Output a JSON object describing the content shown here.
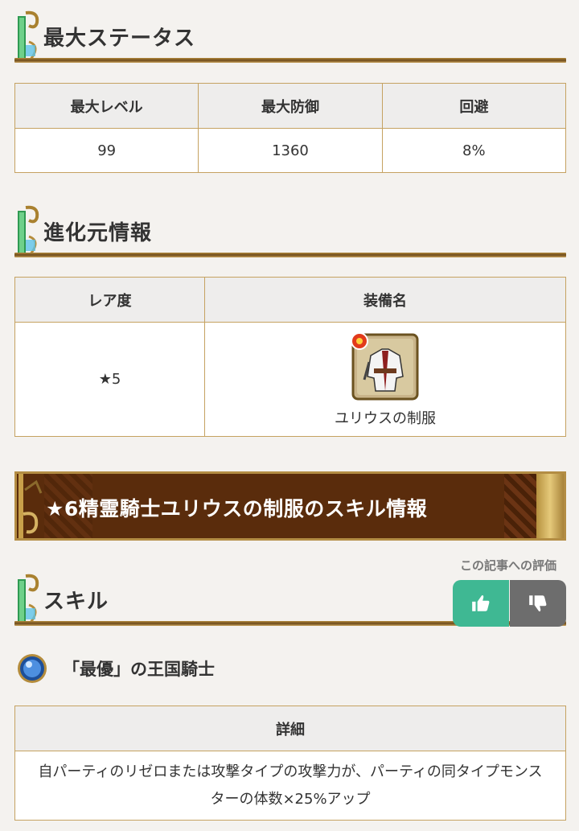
{
  "sections": {
    "max_status": "最大ステータス",
    "evolution_source": "進化元情報",
    "skill": "スキル"
  },
  "max_status_table": {
    "headers": [
      "最大レベル",
      "最大防御",
      "回避"
    ],
    "values": [
      "99",
      "1360",
      "8%"
    ]
  },
  "evolution_table": {
    "headers": [
      "レア度",
      "装備名"
    ],
    "rarity": "★5",
    "equipment_name": "ユリウスの制服",
    "equipment_icon": "uniform-icon"
  },
  "skill_info_banner": "★6精霊騎士ユリウスの制服のスキル情報",
  "rating": {
    "label": "この記事への評価",
    "good_icon": "thumbs-up-icon",
    "bad_icon": "thumbs-down-icon"
  },
  "skill": {
    "icon": "blue-orb-icon",
    "name": "「最優」の王国騎士",
    "table_header": "詳細",
    "detail": "自パーティのリゼロまたは攻撃タイプの攻撃力が、パーティの同タイプモンスターの体数×25%アップ"
  },
  "colors": {
    "gold_border": "#c5a261",
    "banner_bg": "#5a2c0c",
    "good_button": "#3fb893",
    "bad_button": "#6d6d6d"
  }
}
